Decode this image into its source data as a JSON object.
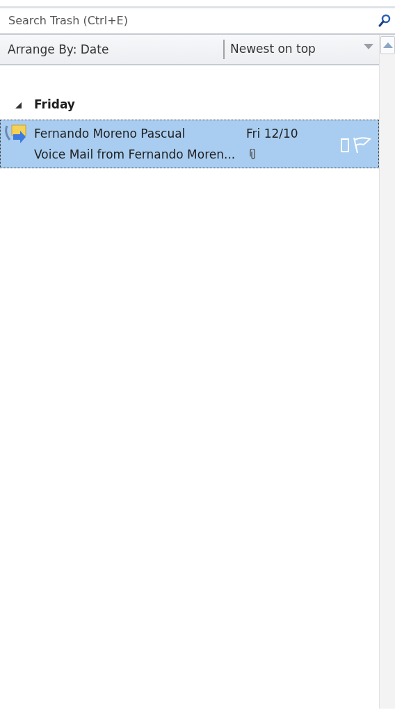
{
  "search": {
    "placeholder": "Search Trash (Ctrl+E)"
  },
  "arrange": {
    "label": "Arrange By: Date",
    "order": "Newest on top"
  },
  "groups": [
    {
      "label": "Friday",
      "expanded": true,
      "messages": [
        {
          "sender": "Fernando Moreno Pascual",
          "date": "Fri 12/10",
          "subject": "Voice Mail from Fernando Moren...",
          "selected": true,
          "attachment": true
        }
      ]
    }
  ]
}
